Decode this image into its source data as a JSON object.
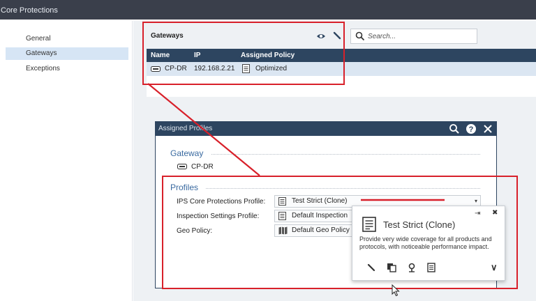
{
  "window": {
    "title": "Core Protections"
  },
  "sidebar": {
    "collapse_glyph": "«",
    "items": [
      {
        "label": "General",
        "active": false
      },
      {
        "label": "Gateways",
        "active": true
      },
      {
        "label": "Exceptions",
        "active": false
      }
    ]
  },
  "gateways_panel": {
    "title": "Gateways",
    "toolbar_icons": [
      "eye-icon",
      "edit-icon"
    ],
    "search": {
      "placeholder": "Search...",
      "value": ""
    },
    "columns": [
      "Name",
      "IP",
      "Assigned Policy"
    ],
    "rows": [
      {
        "name": "CP-DR",
        "ip": "192.168.2.21",
        "policy": "Optimized"
      }
    ]
  },
  "dialog": {
    "title": "Assigned Profiles",
    "titlebar_icons": [
      "search-icon",
      "help-icon",
      "close-icon"
    ],
    "gateway_section": {
      "heading": "Gateway",
      "gateway_name": "CP-DR"
    },
    "profiles_section": {
      "heading": "Profiles",
      "fields": [
        {
          "label": "IPS Core Protections Profile:",
          "value": "Test Strict (Clone)"
        },
        {
          "label": "Inspection Settings Profile:",
          "value": "Default Inspection"
        },
        {
          "label": "Geo Policy:",
          "value": "Default Geo Policy"
        }
      ]
    }
  },
  "popup": {
    "title": "Test Strict (Clone)",
    "description": "Provide very wide coverage for all products and protocols, with noticeable performance impact.",
    "action_icons": [
      "edit-icon",
      "copy-icon",
      "location-icon",
      "list-icon"
    ],
    "pin_glyph": "⇥",
    "close_glyph": "✖",
    "expand_glyph": "∨"
  },
  "colors": {
    "titlebar": "#3a3f4b",
    "header_navy": "#2d4560",
    "selected_row": "#dbe6f2",
    "section_blue": "#3a6aa0",
    "annotation_red": "#d8202a"
  }
}
